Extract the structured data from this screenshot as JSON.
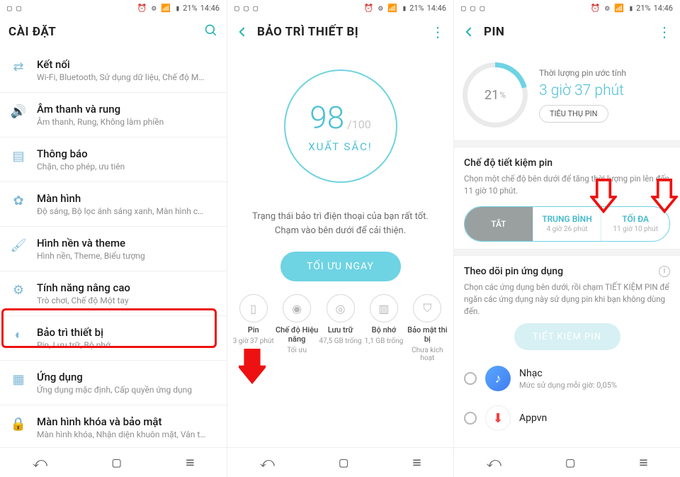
{
  "status": {
    "time": "14:46",
    "battery": "21%",
    "left1": "▢ ▢",
    "left2": "▢ ▢ ▢",
    "right": "⏰ ⚙ 📶 ▮"
  },
  "panel1": {
    "title": "CÀI ĐẶT",
    "rows": [
      {
        "title": "Kết nối",
        "sub": "Wi-Fi, Bluetooth, Sử dụng dữ liệu, Chế độ M…",
        "icon": "connect-icon",
        "glyph": "⇄"
      },
      {
        "title": "Âm thanh và rung",
        "sub": "Âm thanh, Rung, Không làm phiền",
        "icon": "sound-icon",
        "glyph": "🔊"
      },
      {
        "title": "Thông báo",
        "sub": "Chặn, cho phép, ưu tiên",
        "icon": "notification-icon",
        "glyph": "▤"
      },
      {
        "title": "Màn hình",
        "sub": "Độ sáng, Bộ lọc ánh sáng xanh, Màn hình c…",
        "icon": "display-icon",
        "glyph": "✿"
      },
      {
        "title": "Hình nền và theme",
        "sub": "Hình nền, Theme, Biểu tượng",
        "icon": "theme-icon",
        "glyph": "🖌"
      },
      {
        "title": "Tính năng nâng cao",
        "sub": "Trò chơi, Chế độ Một tay",
        "icon": "advanced-icon",
        "glyph": "⚙"
      },
      {
        "title": "Bảo trì thiết bị",
        "sub": "Pin, Lưu trữ, Bộ nhớ",
        "icon": "maintenance-icon",
        "glyph": "◐"
      },
      {
        "title": "Ứng dụng",
        "sub": "Ứng dụng mặc định, Cấp quyền ứng dụng",
        "icon": "apps-icon",
        "glyph": "▦"
      },
      {
        "title": "Màn hình khóa và bảo mật",
        "sub": "Màn hình khóa, Nhận diện khuôn mặt, Vân t…",
        "icon": "security-icon",
        "glyph": "🔒"
      }
    ]
  },
  "panel2": {
    "title": "BẢO TRÌ THIẾT BỊ",
    "score": "98",
    "denom": "/100",
    "status_label": "XUẤT SẮC!",
    "desc1": "Trạng thái bảo trì điện thoại của bạn rất tốt.",
    "desc2": "Chạm vào bên dưới để cải thiện.",
    "opt_btn": "TỐI ƯU NGAY",
    "cats": [
      {
        "name": "Pin",
        "sub": "3 giờ 37 phút",
        "glyph": "▯"
      },
      {
        "name": "Chế độ Hiệu năng",
        "sub": "Tối ưu",
        "glyph": "◉"
      },
      {
        "name": "Lưu trữ",
        "sub": "47,5 GB trống",
        "glyph": "◎"
      },
      {
        "name": "Bộ nhớ",
        "sub": "1,1 GB trống",
        "glyph": "▥"
      },
      {
        "name": "Bảo mật thi bị",
        "sub": "Chưa kích hoạt",
        "glyph": "⛉"
      }
    ]
  },
  "panel3": {
    "title": "PIN",
    "ring_pct": "21",
    "ring_pct_sym": "%",
    "est_label": "Thời lượng pin ước tính",
    "est_value": "3 giờ 37 phút",
    "usage_btn": "TIÊU THỤ PIN",
    "save_title": "Chế độ tiết kiệm pin",
    "save_desc": "Chọn một chế độ bên dưới để tăng thời lượng pin lên đến 11 giờ 10 phút.",
    "modes": [
      {
        "name": "TẮT",
        "sub": ""
      },
      {
        "name": "TRUNG BÌNH",
        "sub": "4 giờ 26 phút"
      },
      {
        "name": "TỐI ĐA",
        "sub": "11 giờ 10 phút"
      }
    ],
    "monitor_title": "Theo dõi pin ứng dụng",
    "monitor_desc": "Chọn các ứng dụng bên dưới, rồi chạm TIẾT KIỆM PIN để ngăn các ứng dụng này sử dụng pin khi bạn không dùng đến.",
    "monitor_btn": "TIẾT KIỆM PIN",
    "apps": [
      {
        "name": "Nhạc",
        "sub": "Mức sử dụng mỗi giờ: 0,05%"
      },
      {
        "name": "Appvn",
        "sub": ""
      }
    ]
  }
}
